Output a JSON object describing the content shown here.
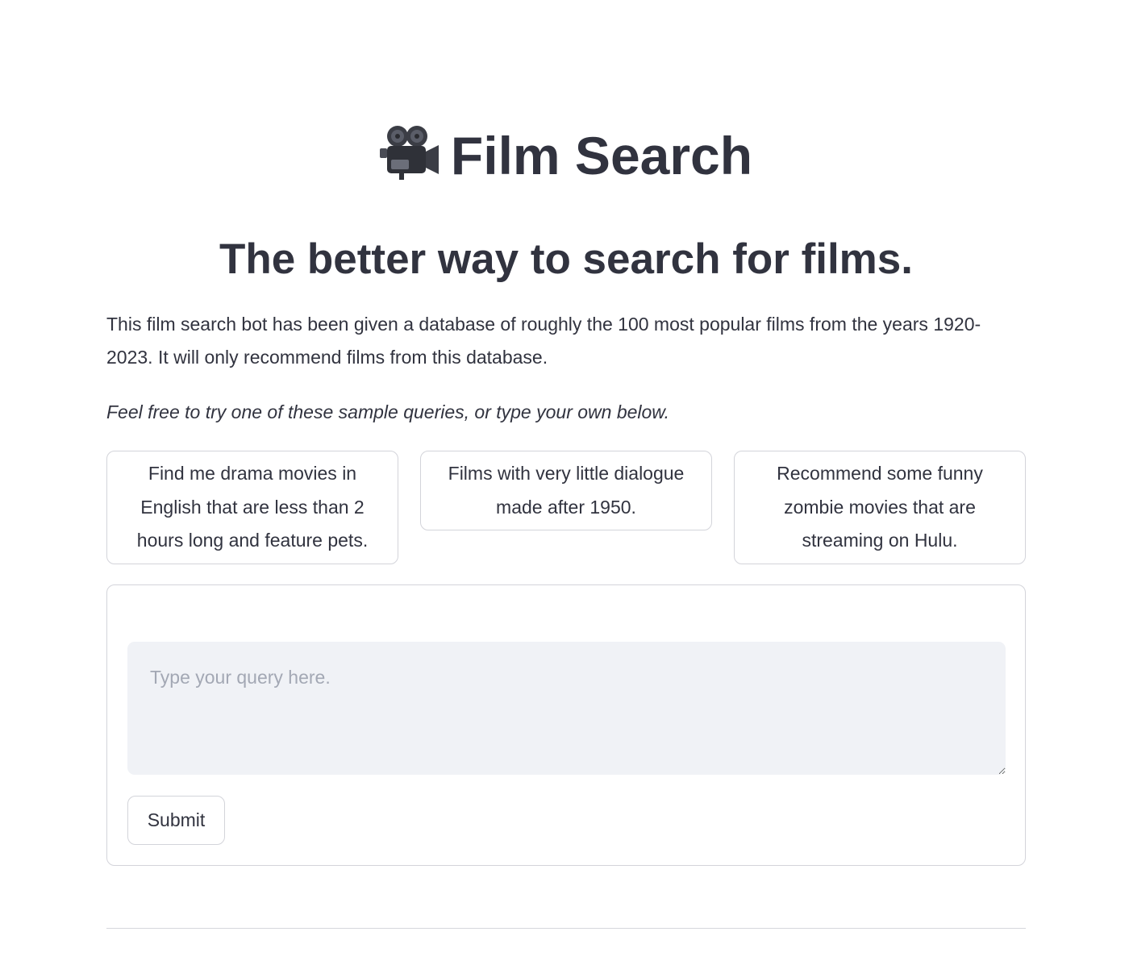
{
  "header": {
    "icon": "movie-camera-icon",
    "title": "Film Search"
  },
  "subtitle": "The better way to search for films.",
  "intro": "This film search bot has been given a database of roughly the 100 most popular films from the years 1920-2023. It will only recommend films from this database.",
  "hint": "Feel free to try one of these sample queries, or type your own below.",
  "samples": [
    {
      "label": "Find me drama movies in English that are less than 2 hours long and feature pets."
    },
    {
      "label": "Films with very little dialogue made after 1950."
    },
    {
      "label": "Recommend some funny zombie movies that are streaming on Hulu."
    }
  ],
  "form": {
    "query_value": "",
    "query_placeholder": "Type your query here.",
    "submit_label": "Submit"
  },
  "colors": {
    "text": "#31333f",
    "border": "#d3d4da",
    "input_bg": "#f0f2f6",
    "placeholder": "#a3a8b4"
  }
}
